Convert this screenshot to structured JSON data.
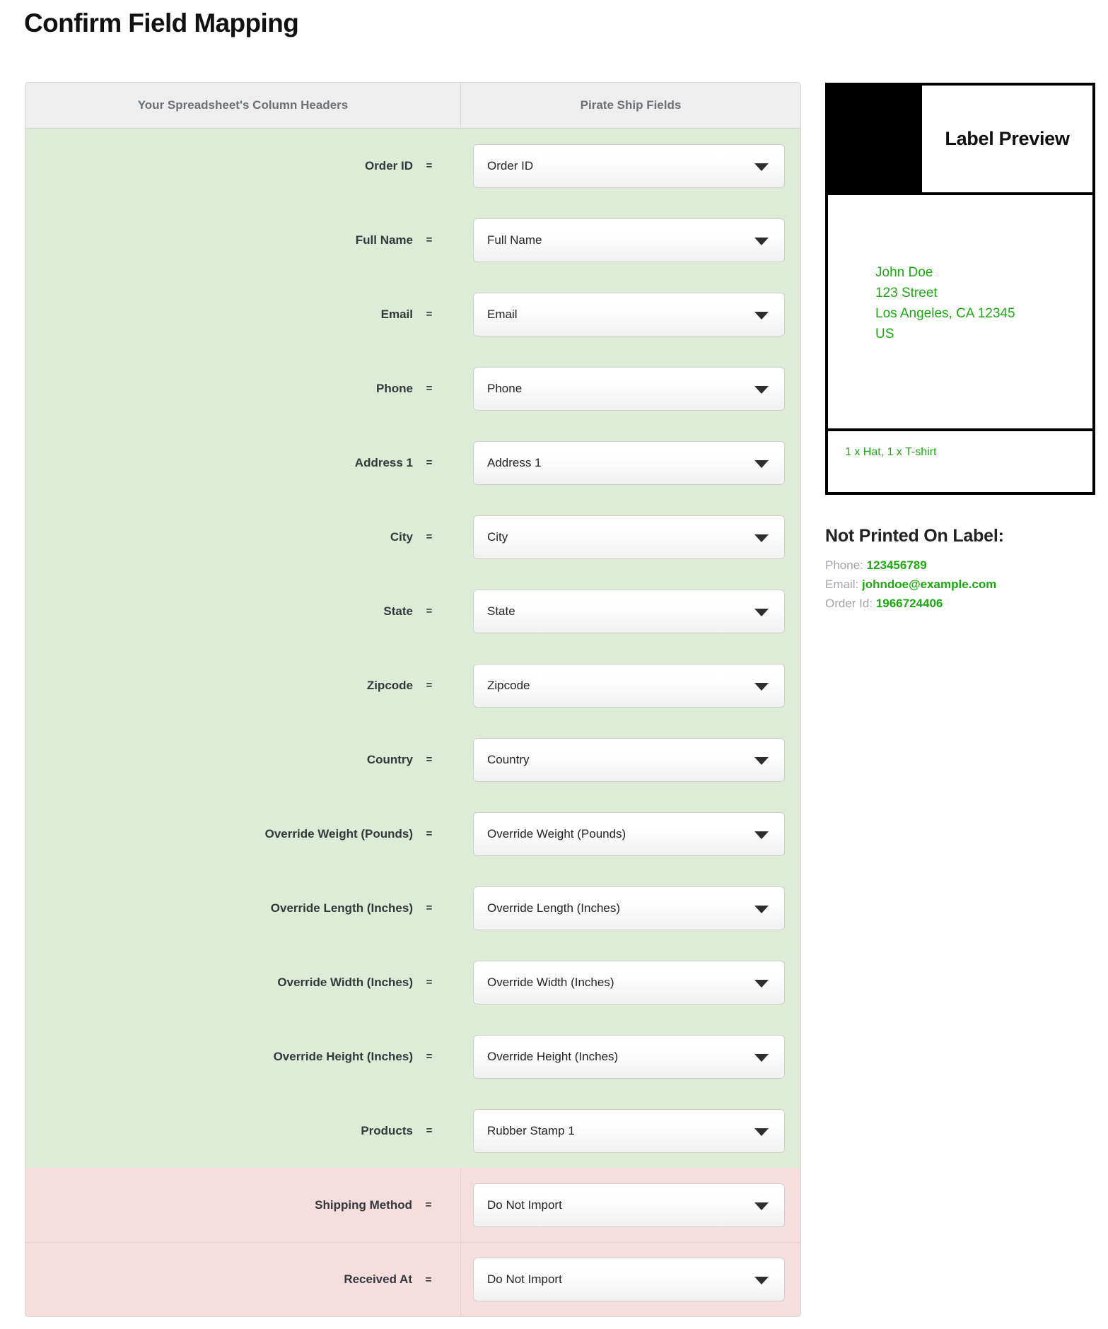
{
  "page": {
    "title": "Confirm Field Mapping"
  },
  "table": {
    "header_left": "Your Spreadsheet's Column Headers",
    "header_right": "Pirate Ship Fields",
    "equals_symbol": "=",
    "rows": [
      {
        "sheet_column": "Order ID",
        "mapped_field": "Order ID",
        "status": "ok"
      },
      {
        "sheet_column": "Full Name",
        "mapped_field": "Full Name",
        "status": "ok"
      },
      {
        "sheet_column": "Email",
        "mapped_field": "Email",
        "status": "ok"
      },
      {
        "sheet_column": "Phone",
        "mapped_field": "Phone",
        "status": "ok"
      },
      {
        "sheet_column": "Address 1",
        "mapped_field": "Address 1",
        "status": "ok"
      },
      {
        "sheet_column": "City",
        "mapped_field": "City",
        "status": "ok"
      },
      {
        "sheet_column": "State",
        "mapped_field": "State",
        "status": "ok"
      },
      {
        "sheet_column": "Zipcode",
        "mapped_field": "Zipcode",
        "status": "ok"
      },
      {
        "sheet_column": "Country",
        "mapped_field": "Country",
        "status": "ok"
      },
      {
        "sheet_column": "Override Weight (Pounds)",
        "mapped_field": "Override Weight (Pounds)",
        "status": "ok"
      },
      {
        "sheet_column": "Override Length (Inches)",
        "mapped_field": "Override Length (Inches)",
        "status": "ok"
      },
      {
        "sheet_column": "Override Width (Inches)",
        "mapped_field": "Override Width (Inches)",
        "status": "ok"
      },
      {
        "sheet_column": "Override Height (Inches)",
        "mapped_field": "Override Height (Inches)",
        "status": "ok"
      },
      {
        "sheet_column": "Products",
        "mapped_field": "Rubber Stamp 1",
        "status": "ok"
      },
      {
        "sheet_column": "Shipping Method",
        "mapped_field": "Do Not Import",
        "status": "skip"
      },
      {
        "sheet_column": "Received At",
        "mapped_field": "Do Not Import",
        "status": "skip"
      }
    ]
  },
  "preview": {
    "title": "Label Preview",
    "address_lines": [
      "John Doe",
      "123 Street",
      "Los Angeles, CA 12345",
      "US"
    ],
    "items": "1 x Hat, 1 x T-shirt",
    "not_printed_title": "Not Printed On Label:",
    "not_printed": [
      {
        "label": "Phone: ",
        "value": "123456789"
      },
      {
        "label": "Email: ",
        "value": "johndoe@example.com"
      },
      {
        "label": "Order Id: ",
        "value": "1966724406"
      }
    ]
  },
  "colors": {
    "row_ok_bg": "#deecd7",
    "row_skip_bg": "#f4dede",
    "header_bg": "#eeeeee",
    "green_text": "#1ba810",
    "muted_text": "#a0a4a8"
  }
}
